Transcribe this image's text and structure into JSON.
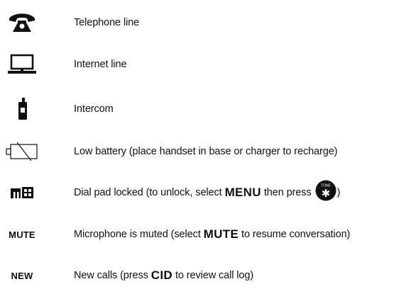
{
  "legend": [
    {
      "icon": "telephone-icon",
      "parts": [
        "Telephone line"
      ]
    },
    {
      "icon": "monitor-icon",
      "parts": [
        "Internet line"
      ]
    },
    {
      "icon": "intercom-handset-icon",
      "parts": [
        "Intercom"
      ]
    },
    {
      "icon": "low-battery-icon",
      "parts": [
        "Low battery (place handset in base or charger to recharge)"
      ]
    },
    {
      "icon": "dial-pad-lock-icon",
      "parts": [
        "Dial pad locked (to unlock, select",
        "MENU",
        "then press",
        ")"
      ],
      "inline_icon": "tone-star-key-icon",
      "inline_icon_label": "TONE",
      "inline_icon_symbol": "✱"
    },
    {
      "icon_text": "MUTE",
      "parts": [
        "Microphone is muted (select",
        "MUTE",
        "to resume conversation)"
      ]
    },
    {
      "icon_text": "NEW",
      "parts": [
        "New calls (press",
        "CID",
        "to review call log)"
      ]
    }
  ]
}
